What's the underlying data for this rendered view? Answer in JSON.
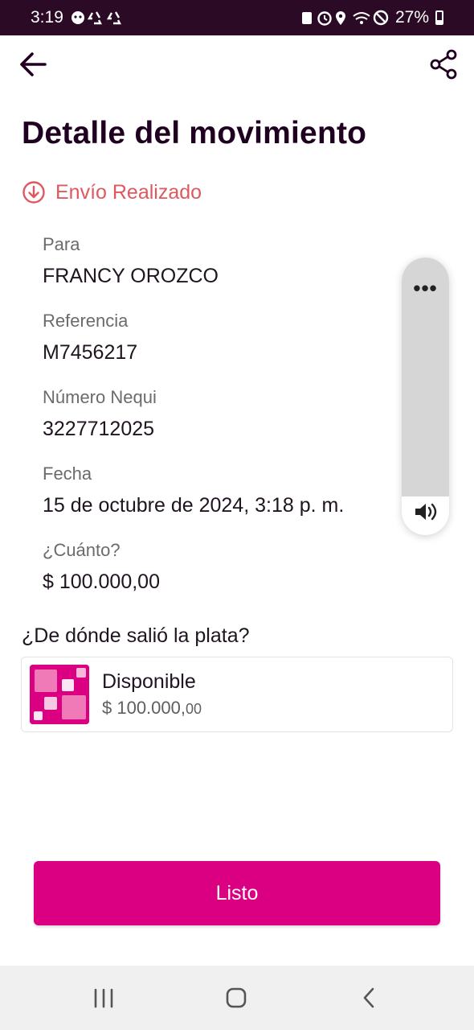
{
  "status_bar": {
    "time": "3:19",
    "battery": "27%",
    "colors": {
      "background": "#2a0a24",
      "text": "#ffffff"
    }
  },
  "header": {
    "back_icon": "arrow-left-icon",
    "share_icon": "share-icon",
    "title": "Detalle del movimiento"
  },
  "transaction": {
    "status_icon": "arrow-down-circle-icon",
    "status_text": "Envío Realizado",
    "status_color": "#e0585f",
    "fields": [
      {
        "label": "Para",
        "value": "FRANCY OROZCO"
      },
      {
        "label": "Referencia",
        "value": "M7456217"
      },
      {
        "label": "Número Nequi",
        "value": "3227712025"
      },
      {
        "label": "Fecha",
        "value": "15 de octubre de 2024, 3:18 p. m."
      },
      {
        "label": "¿Cuánto?",
        "value": "$ 100.000,00"
      }
    ]
  },
  "volume_overlay": {
    "menu_glyph": "•••",
    "icon": "volume-icon"
  },
  "source": {
    "title": "¿De dónde salió la plata?",
    "name": "Disponible",
    "amount_main": "$ 100.000,",
    "amount_cents": "00",
    "logo_icon": "nequi-pocket-icon",
    "brand_color": "#da0081"
  },
  "actions": {
    "done_label": "Listo",
    "done_color": "#db0081"
  },
  "nav_bar": {
    "recents_icon": "recent-apps-icon",
    "home_icon": "home-icon",
    "back_icon": "back-chevron-icon"
  }
}
